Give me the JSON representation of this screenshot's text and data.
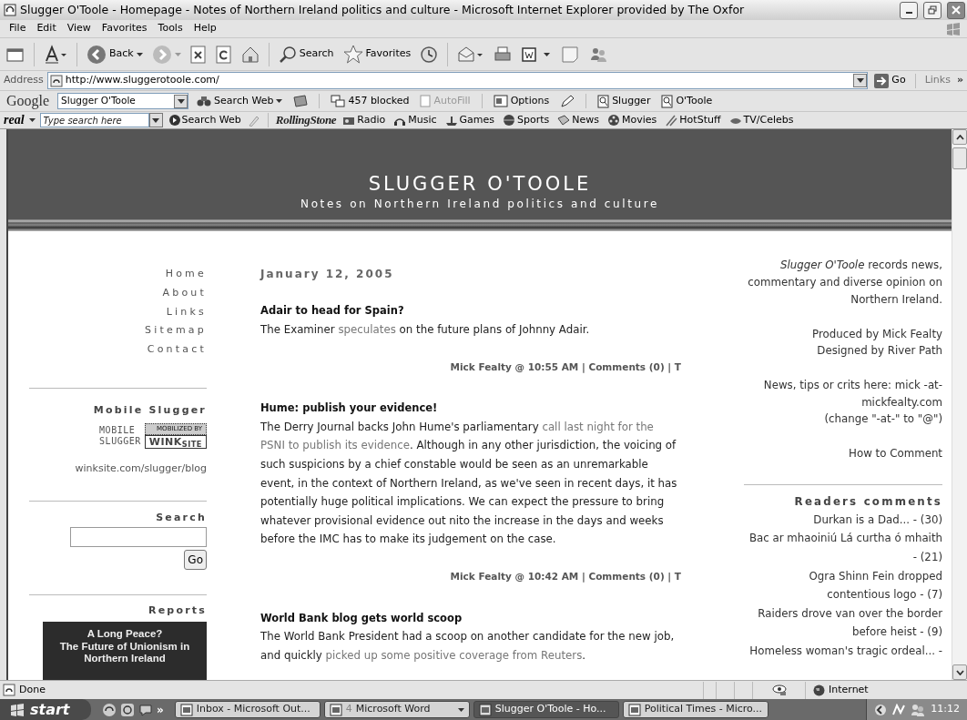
{
  "window": {
    "title": "Slugger O'Toole - Homepage - Notes of Northern Ireland politics and culture - Microsoft Internet Explorer provided by The Oxfor"
  },
  "menu": [
    "File",
    "Edit",
    "View",
    "Favorites",
    "Tools",
    "Help"
  ],
  "toolbar": {
    "back": "Back",
    "search": "Search",
    "favorites": "Favorites"
  },
  "address_bar": {
    "label": "Address",
    "url": "http://www.sluggerotoole.com/",
    "go": "Go",
    "links": "Links",
    "more": "»"
  },
  "google_toolbar": {
    "logo": "Google",
    "query": "Slugger O'Toole",
    "search_web": "Search Web",
    "blocked": "457 blocked",
    "autofill": {
      "label": "AutoFill",
      "disabled": true
    },
    "options": "Options",
    "highlights": [
      "Slugger",
      "O'Toole"
    ]
  },
  "real_toolbar": {
    "logo": "real",
    "placeholder": "Type search here",
    "search_web": "Search Web",
    "rolling_stone": "RollingStone",
    "links": [
      "Radio",
      "Music",
      "Games",
      "Sports",
      "News",
      "Movies",
      "HotStuff",
      "TV/Celebs"
    ]
  },
  "site": {
    "title": "SLUGGER O'TOOLE",
    "tagline": "Notes on Northern Ireland politics and culture"
  },
  "nav": [
    "Home",
    "About",
    "Links",
    "Sitemap",
    "Contact"
  ],
  "mobile": {
    "heading": "Mobile Slugger",
    "logo_lines": [
      "MOBILE",
      "SLUGGER"
    ],
    "badge_top": "MOBILIZED BY",
    "badge_brand": "WINK$_{SITE}$",
    "url": "winksite.com/slugger/blog"
  },
  "search": {
    "heading": "Search",
    "button": "Go"
  },
  "reports": {
    "heading": "Reports",
    "banner": [
      "A Long Peace?",
      "The Future of Unionism in",
      "Northern Ireland"
    ]
  },
  "date": "January 12, 2005",
  "posts": [
    {
      "title": "Adair to head for Spain?",
      "body": [
        {
          "text": "The Examiner ",
          "link": false
        },
        {
          "text": "speculates",
          "link": true
        },
        {
          "text": " on the future plans of Johnny Adair.",
          "link": false
        }
      ],
      "byline": "Mick Fealty @ 10:55 AM | Comments (0) | T"
    },
    {
      "title": "Hume: publish your evidence!",
      "body": [
        {
          "text": "The Derry Journal backs John Hume's parliamentary ",
          "link": false
        },
        {
          "text": "call last night for the",
          "link": true
        },
        {
          "text": "PSNI to publish its evidence",
          "link": true
        },
        {
          "text": ". Although in any other jurisdiction, the voicing of such suspicions by a chief constable would be seen as an unremarkable event, in the context of Northern Ireland, as we've seen in recent days, it has potentially huge political implications. We can expect the pressure to bring whatever provisional evidence out nito the increase in the days and weeks before the IMC has to make its judgement on the case.",
          "link": false
        }
      ],
      "byline": "Mick Fealty @ 10:42 AM | Comments (0) | T"
    },
    {
      "title": "World Bank blog gets world scoop",
      "body": [
        {
          "text": "The World Bank President had a scoop on another candidate for the new job, and quickly ",
          "link": false
        },
        {
          "text": "picked up some positive coverage from Reuters",
          "link": true
        },
        {
          "text": ".",
          "link": false
        }
      ]
    }
  ],
  "right": {
    "intro": "*Slugger O'Toole* records news, commentary and diverse opinion on Northern Ireland.",
    "credits": [
      "Produced by Mick Fealty",
      "Designed by River Path"
    ],
    "contact": [
      "News, tips or crits here: mick -at- mickfealty.com",
      "(change \"-at-\" to \"@\")"
    ],
    "how_to": "How to Comment",
    "comments_heading": "Readers comments",
    "comments": [
      "Durkan is a Dad... - (30)",
      "Bac ar mhaoiniú Lá curtha ó mhaith - (21)",
      "Ogra Shinn Fein dropped contentious logo - (7)",
      "Raiders drove van over the border before heist - (9)",
      "Homeless woman's tragic ordeal... -"
    ]
  },
  "status_bar": {
    "text": "Done",
    "zone": "Internet"
  },
  "taskbar": {
    "start": "start",
    "more": "»",
    "buttons": [
      {
        "label": "Inbox - Microsoft Out...",
        "selected": false
      },
      {
        "count": "4",
        "label": "Microsoft Word",
        "selected": false,
        "group": true
      },
      {
        "label": "Slugger O'Toole - Ho...",
        "selected": true
      },
      {
        "label": "Political Times - Micro...",
        "selected": false
      }
    ],
    "clock": "11:12"
  }
}
